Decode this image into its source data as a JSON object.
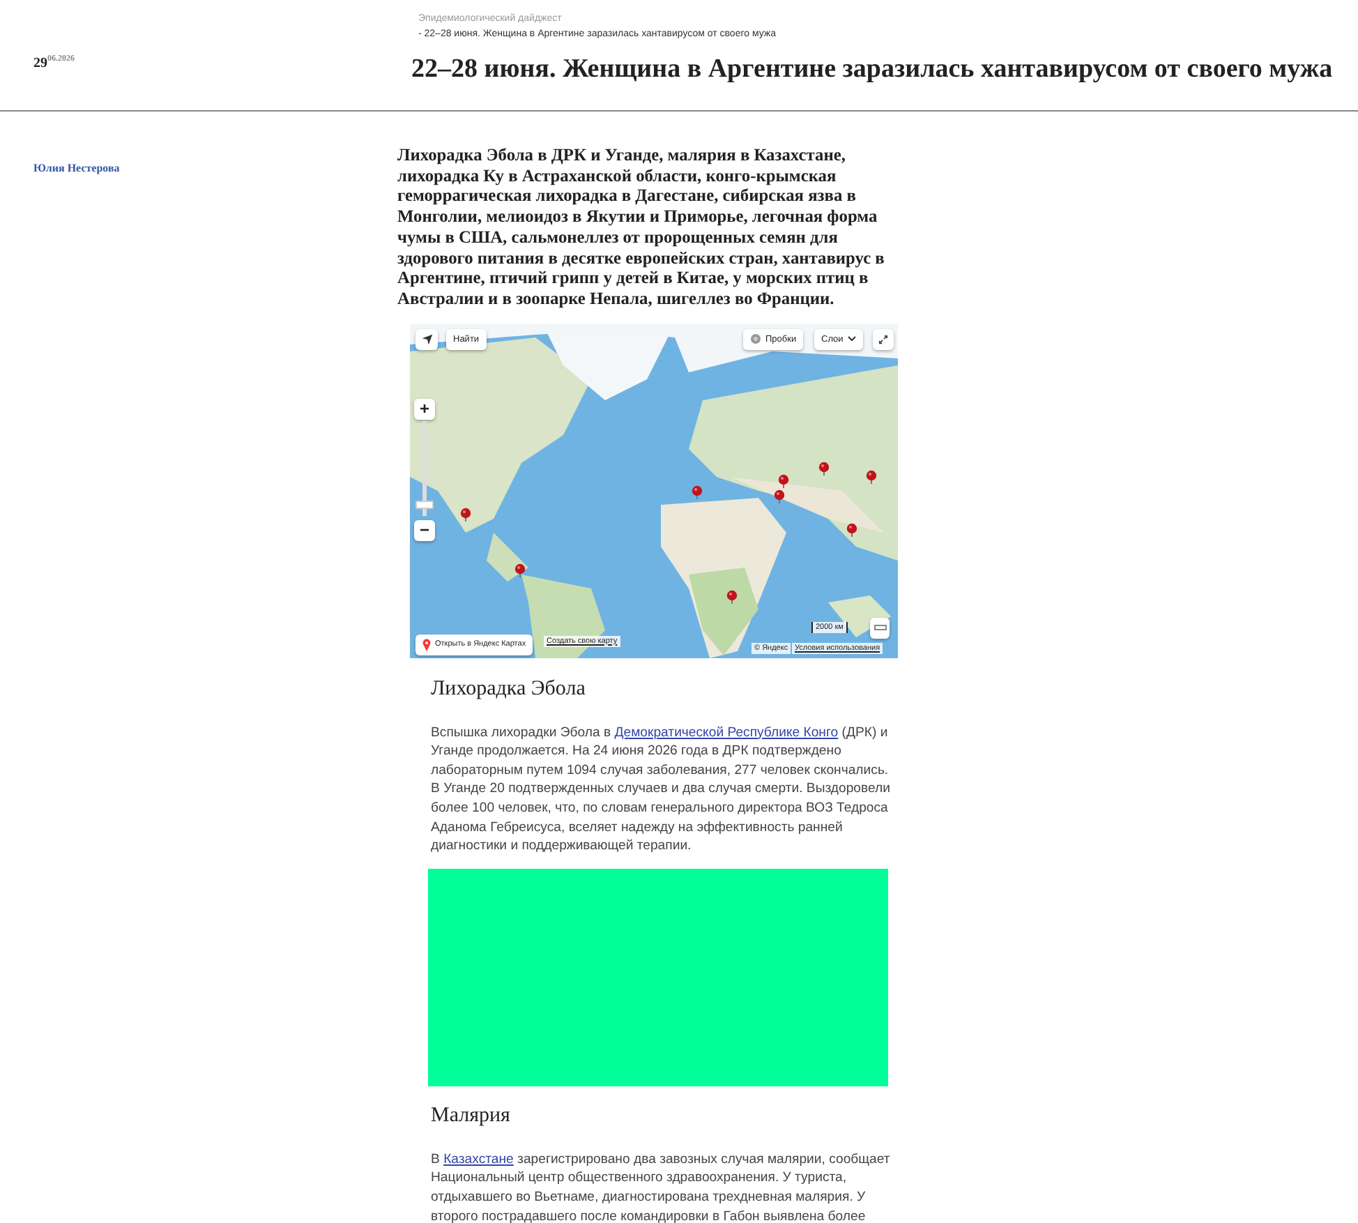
{
  "breadcrumb": {
    "section": "Эпидемиологический дайджест",
    "current": "- 22–28 июня. Женщина в Аргентине заразилась хантавирусом от своего мужа"
  },
  "date": {
    "day": "29",
    "month_year": "06.2026"
  },
  "title": "22–28 июня. Женщина в Аргентине заразилась хантавирусом от своего мужа",
  "author": "Юлия Нестерова",
  "lead": "Лихорадка Эбола в ДРК и Уганде, малярия в Казахстане, лихорадка Ку в Астраханской области, конго-крымская геморрагическая лихорадка в Дагестане, сибирская язва в Монголии, мелиоидоз в Якутии и Приморье, легочная форма чумы в США, сальмонеллез от пророщенных семян для здорового питания в десятке европейских стран, хантавирус в Аргентине, птичий грипп у детей в Китае, у морских птиц в Австралии и в зоопарке Непала, шигеллез во Франции.",
  "map": {
    "kind": "picture",
    "zoom_slider": {
      "level": 0.08
    },
    "search_button": "Найти",
    "traffic_button": "Пробки",
    "layers_button": "Слои",
    "zoom_in": "+",
    "zoom_out": "−",
    "open_link": "Открыть в Яндекс Картах",
    "create_link": "Создать свою карту",
    "scale": "2000 км",
    "copyright": "© Яндекс",
    "terms_link": "Условия использования"
  },
  "sections": [
    {
      "kind": "heading",
      "text": "Лихорадка Эбола"
    },
    {
      "kind": "paragraph",
      "parts": [
        {
          "kind": "plain",
          "text": "Вспышка лихорадки Эбола в "
        },
        {
          "kind": "link",
          "text": "Демократической Республике Конго"
        },
        {
          "kind": "plain",
          "text": " (ДРК) и Уганде продолжается. На 24 июня 2026 года в ДРК подтверждено лабораторным путем 1094 случая заболевания, 277 человек скончались. В Уганде 20 подтвержденных случаев и два случая смерти. Выздоровели более 100 человек, что, по словам генерального директора ВОЗ Тедроса Аданома Гебреисуса, вселяет надежду на эффективность ранней диагностики и поддерживающей терапии."
        }
      ]
    },
    {
      "kind": "block"
    },
    {
      "kind": "heading",
      "text": "Малярия"
    },
    {
      "kind": "paragraph",
      "parts": [
        {
          "kind": "plain",
          "text": "В "
        },
        {
          "kind": "link",
          "text": "Казахстане"
        },
        {
          "kind": "plain",
          "text": " зарегистрировано два завозных случая малярии, сообщает Национальный центр общественного здравоохранения. У туриста, отдыхавшего во Вьетнаме, диагностирована трехдневная малярия. У второго пострадавшего после командировки в Габон выявлена более"
        }
      ]
    }
  ]
}
